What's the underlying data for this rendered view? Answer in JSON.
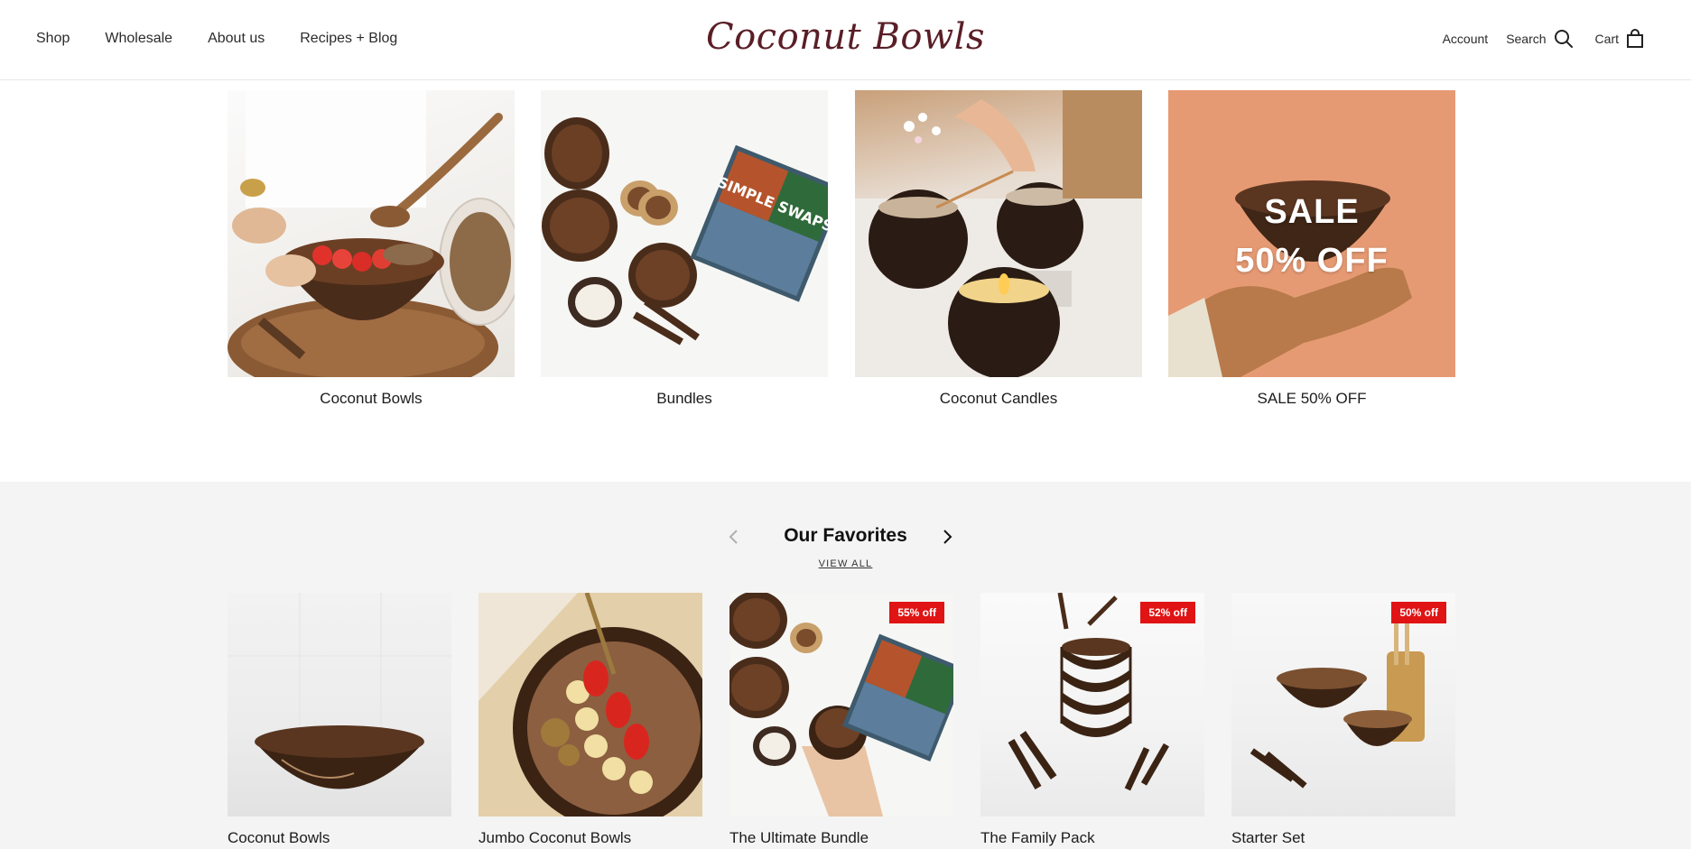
{
  "header": {
    "nav": [
      "Shop",
      "Wholesale",
      "About us",
      "Recipes + Blog"
    ],
    "logo": "Coconut Bowls",
    "account": "Account",
    "search": "Search",
    "cart": "Cart"
  },
  "collections": [
    {
      "label": "Coconut Bowls"
    },
    {
      "label": "Bundles"
    },
    {
      "label": "Coconut Candles"
    },
    {
      "label": "SALE 50% OFF",
      "overlay_line1": "SALE",
      "overlay_line2": "50% OFF"
    }
  ],
  "bundle_book_text": "SIMPLE SWAPS",
  "favorites": {
    "title": "Our Favorites",
    "view_all": "VIEW ALL",
    "products": [
      {
        "name": "Coconut Bowls",
        "badge": ""
      },
      {
        "name": "Jumbo Coconut Bowls",
        "badge": ""
      },
      {
        "name": "The Ultimate Bundle",
        "badge": "55% off"
      },
      {
        "name": "The Family Pack",
        "badge": "52% off"
      },
      {
        "name": "Starter Set",
        "badge": "50% off"
      }
    ]
  },
  "colors": {
    "logo": "#5a1e26",
    "badge": "#e01414",
    "section_bg": "#f4f4f4",
    "coconut": "#4a2c1a"
  }
}
